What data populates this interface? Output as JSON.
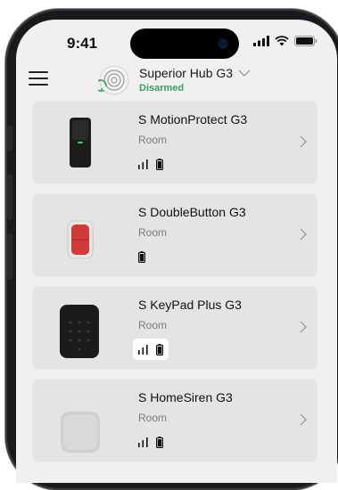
{
  "status_bar": {
    "time": "9:41"
  },
  "header": {
    "hub_name": "Superior Hub G3",
    "hub_state": "Disarmed",
    "state_color": "#3aa05e"
  },
  "devices": [
    {
      "name": "S MotionProtect G3",
      "room": "Room",
      "signal": true,
      "battery": true,
      "highlight": false,
      "icon": "motion-sensor-icon"
    },
    {
      "name": "S DoubleButton G3",
      "room": "Room",
      "signal": false,
      "battery": true,
      "highlight": false,
      "icon": "double-button-icon"
    },
    {
      "name": "S KeyPad Plus G3",
      "room": "Room",
      "signal": true,
      "battery": true,
      "highlight": true,
      "icon": "keypad-icon"
    },
    {
      "name": "S HomeSiren G3",
      "room": "Room",
      "signal": true,
      "battery": true,
      "highlight": false,
      "icon": "siren-icon"
    }
  ]
}
